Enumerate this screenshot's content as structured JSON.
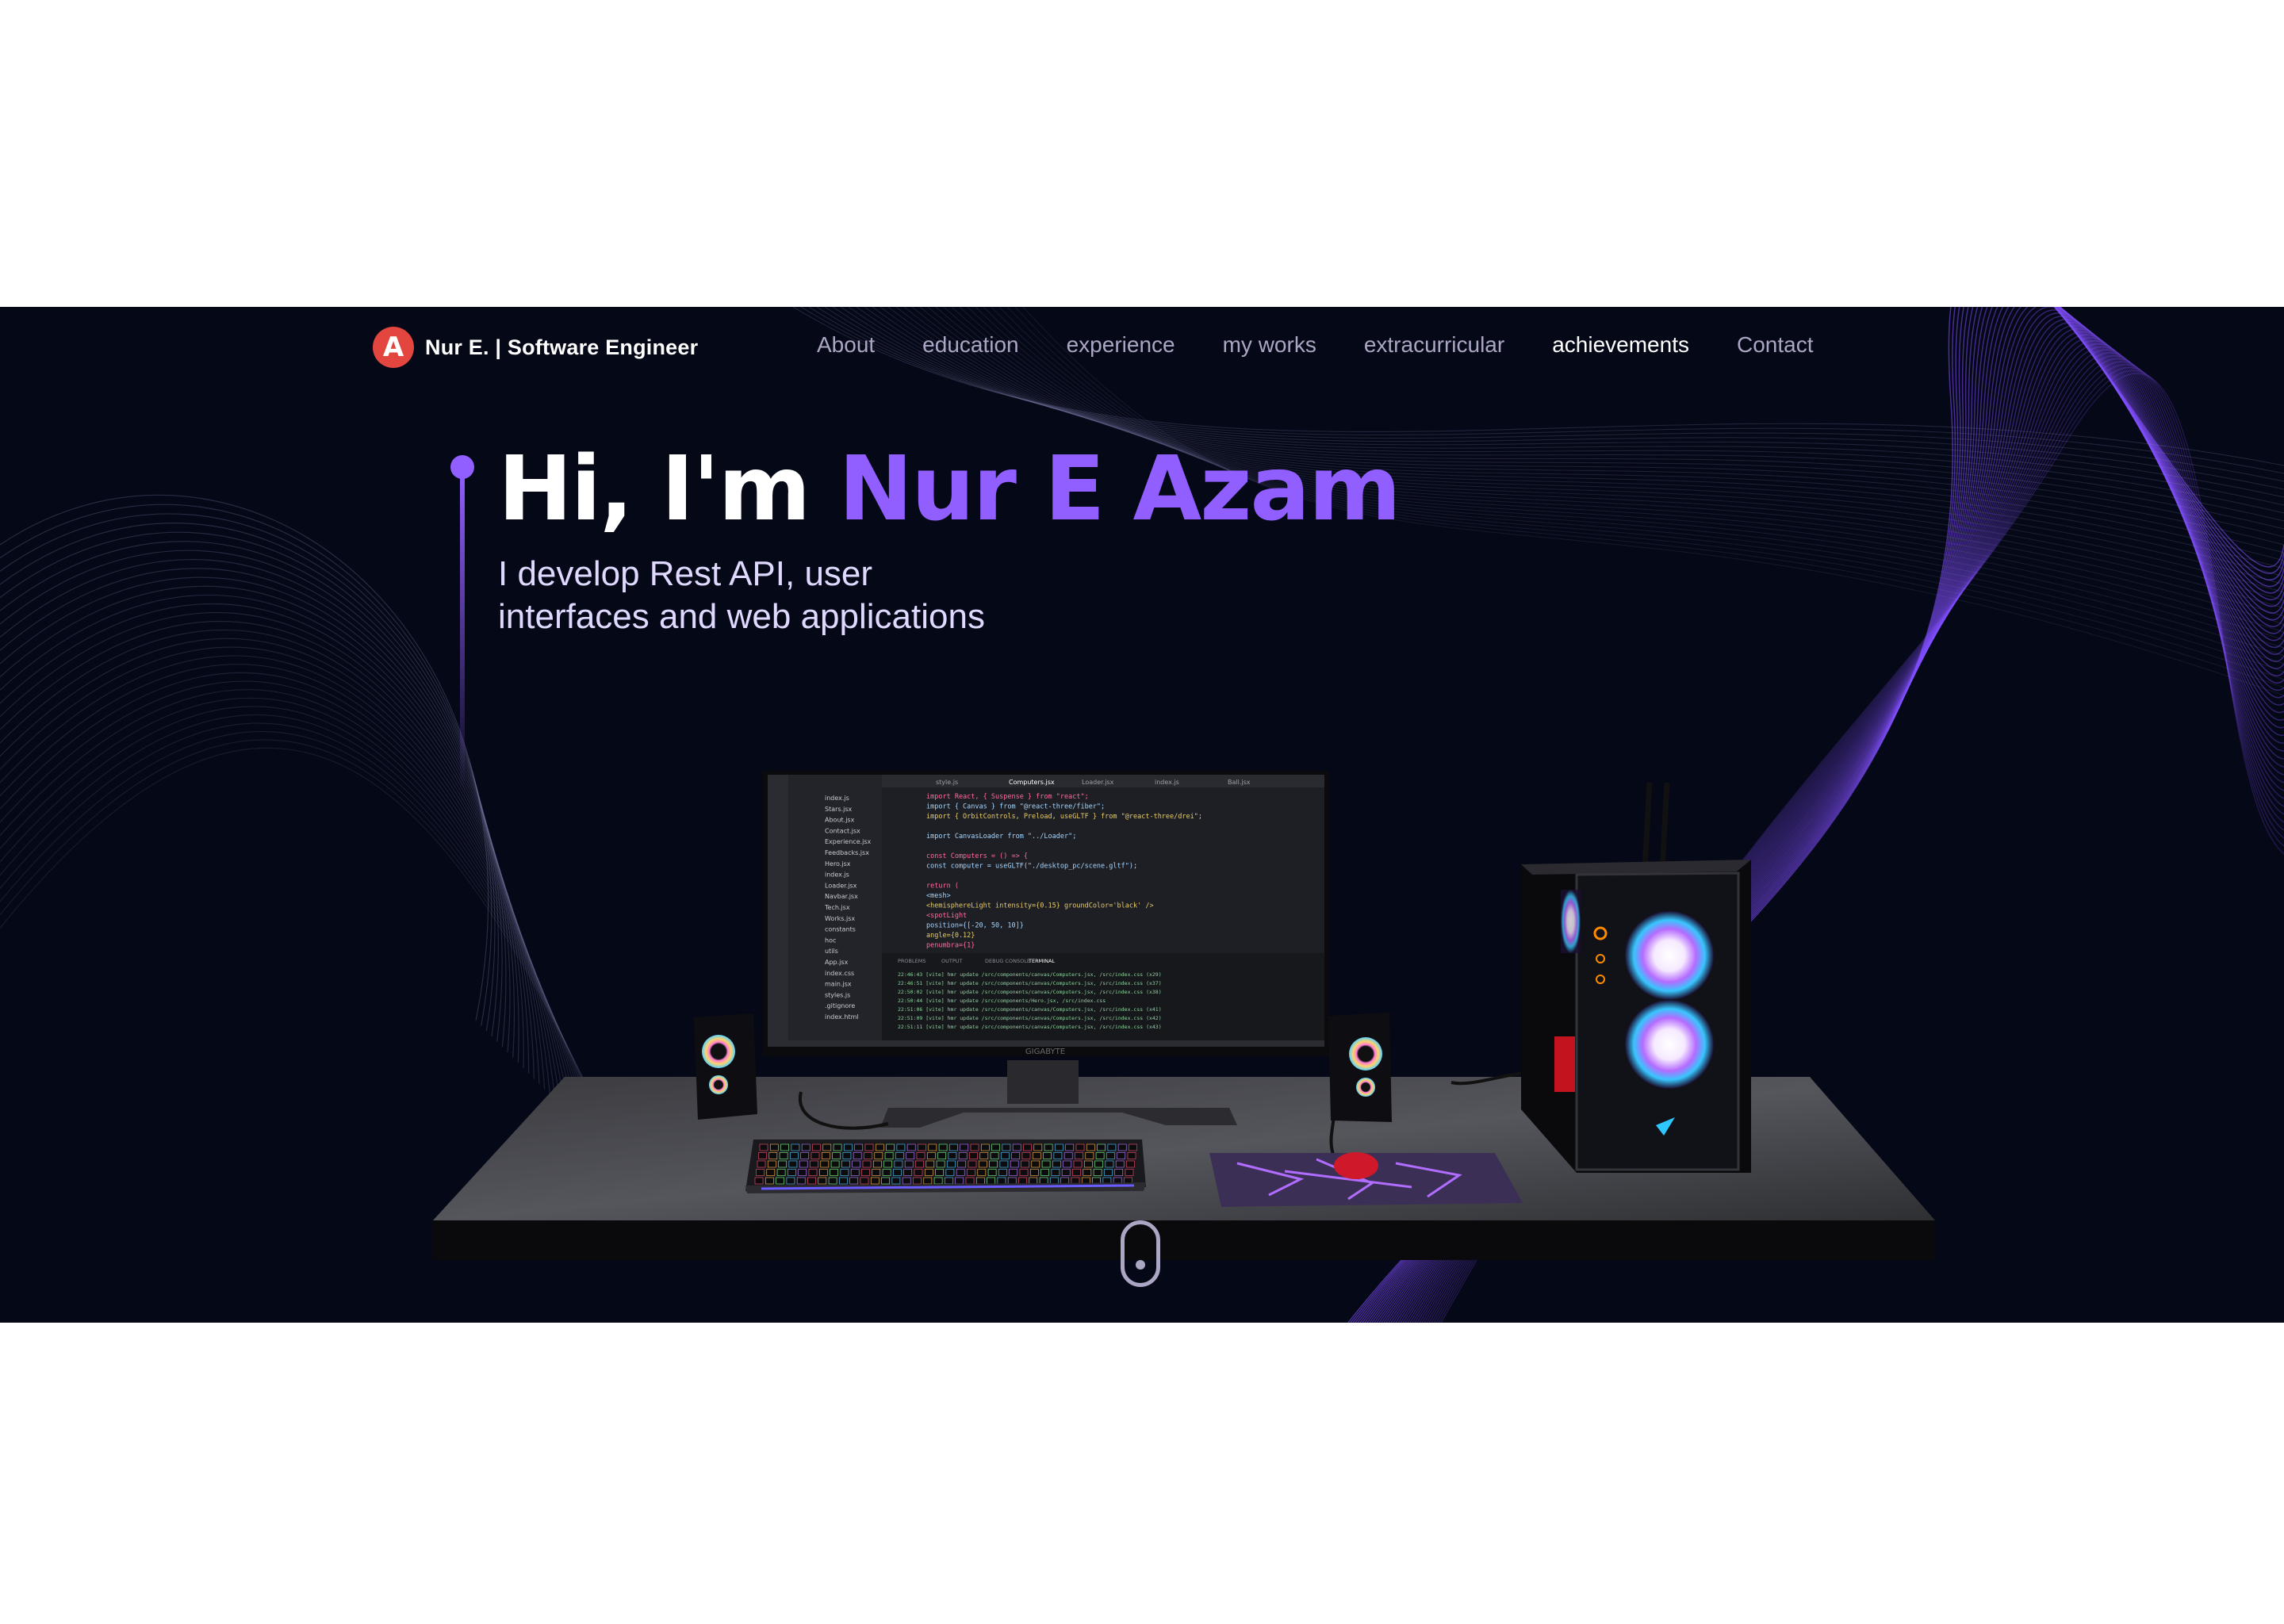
{
  "nav": {
    "logo_letter": "A",
    "brand": "Nur E. | Software Engineer",
    "links": [
      "About",
      "education",
      "experience",
      "my works",
      "extracurricular",
      "achievements",
      "Contact"
    ],
    "active": "achievements"
  },
  "hero": {
    "greeting": "Hi, I'm ",
    "name": "Nur E Azam",
    "subtitle_line1": "I develop Rest API, user",
    "subtitle_line2": "interfaces and web applications"
  },
  "scene": {
    "monitor_brand": "GIGABYTE",
    "editor": {
      "tabs": [
        "style.js",
        "Computers.jsx",
        "Loader.jsx",
        "index.js",
        "Ball.jsx"
      ],
      "files": [
        "index.js",
        "Stars.jsx",
        "About.jsx",
        "Contact.jsx",
        "Experience.jsx",
        "Feedbacks.jsx",
        "Hero.jsx",
        "index.js",
        "Loader.jsx",
        "Navbar.jsx",
        "Tech.jsx",
        "Works.jsx",
        "constants",
        "hoc",
        "utils",
        "App.jsx",
        "index.css",
        "main.jsx",
        "styles.js",
        ".gitignore",
        "index.html"
      ],
      "code": [
        "import React, { Suspense } from \"react\";",
        "import { Canvas } from \"@react-three/fiber\";",
        "import { OrbitControls, Preload, useGLTF } from \"@react-three/drei\";",
        "",
        "import CanvasLoader from \"../Loader\";",
        "",
        "const Computers = () => {",
        "  const computer = useGLTF(\"./desktop_pc/scene.gltf\");",
        "",
        "  return (",
        "    <mesh>",
        "      <hemisphereLight intensity={0.15} groundColor='black' />",
        "      <spotLight",
        "        position={[-20, 50, 10]}",
        "        angle={0.12}",
        "        penumbra={1}"
      ],
      "terminal_tabs": [
        "PROBLEMS",
        "OUTPUT",
        "DEBUG CONSOLE",
        "TERMINAL"
      ],
      "terminal": [
        "22:46:43 [vite] hmr update /src/components/canvas/Computers.jsx, /src/index.css (x29)",
        "22:46:51 [vite] hmr update /src/components/canvas/Computers.jsx, /src/index.css (x37)",
        "22:50:02 [vite] hmr update /src/components/canvas/Computers.jsx, /src/index.css (x38)",
        "22:50:44 [vite] hmr update /src/components/Hero.jsx, /src/index.css",
        "22:51:06 [vite] hmr update /src/components/canvas/Computers.jsx, /src/index.css (x41)",
        "22:51:09 [vite] hmr update /src/components/canvas/Computers.jsx, /src/index.css (x42)",
        "22:51:11 [vite] hmr update /src/components/canvas/Computers.jsx, /src/index.css (x43)"
      ]
    }
  },
  "colors": {
    "background": "#050816",
    "accent": "#915eff",
    "nav_text": "#aaa6c3",
    "logo_red": "#e2463f"
  }
}
